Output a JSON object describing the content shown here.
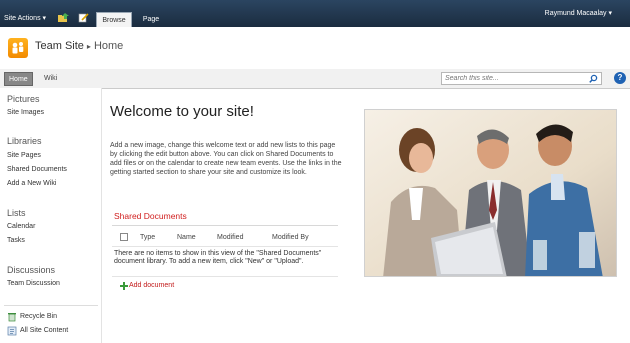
{
  "ribbon": {
    "site_actions": "Site Actions",
    "tabs": [
      "Browse",
      "Page"
    ],
    "user": "Raymund Macaalay"
  },
  "header": {
    "site_name": "Team Site",
    "separator": "▸",
    "page": "Home"
  },
  "topnav": {
    "items": [
      "Home",
      "Wiki"
    ],
    "search_placeholder": "Search this site...",
    "help": "?"
  },
  "leftnav": {
    "sections": [
      {
        "title": "Pictures",
        "links": [
          "Site Images"
        ]
      },
      {
        "title": "Libraries",
        "links": [
          "Site Pages",
          "Shared Documents",
          "Add a New Wiki"
        ]
      },
      {
        "title": "Lists",
        "links": [
          "Calendar",
          "Tasks"
        ]
      },
      {
        "title": "Discussions",
        "links": [
          "Team Discussion"
        ]
      }
    ],
    "bottom": [
      "Recycle Bin",
      "All Site Content"
    ]
  },
  "main": {
    "welcome": "Welcome to your site!",
    "intro": "Add a new image, change this welcome text or add new lists to this page by clicking the edit button above. You can click on Shared Documents to add files or on the calendar to create new team events. Use the links in the getting started section to share your site and customize its look.",
    "shared_title": "Shared Documents",
    "columns": [
      "Type",
      "Name",
      "Modified",
      "Modified By"
    ],
    "empty_text": "There are no items to show in this view of the \"Shared Documents\" document library. To add a new item, click \"New\" or \"Upload\".",
    "add_document": "Add document"
  },
  "colors": {
    "ribbon": "#21374c",
    "accent_red": "#d12020",
    "logo_orange": "#f28a00"
  }
}
